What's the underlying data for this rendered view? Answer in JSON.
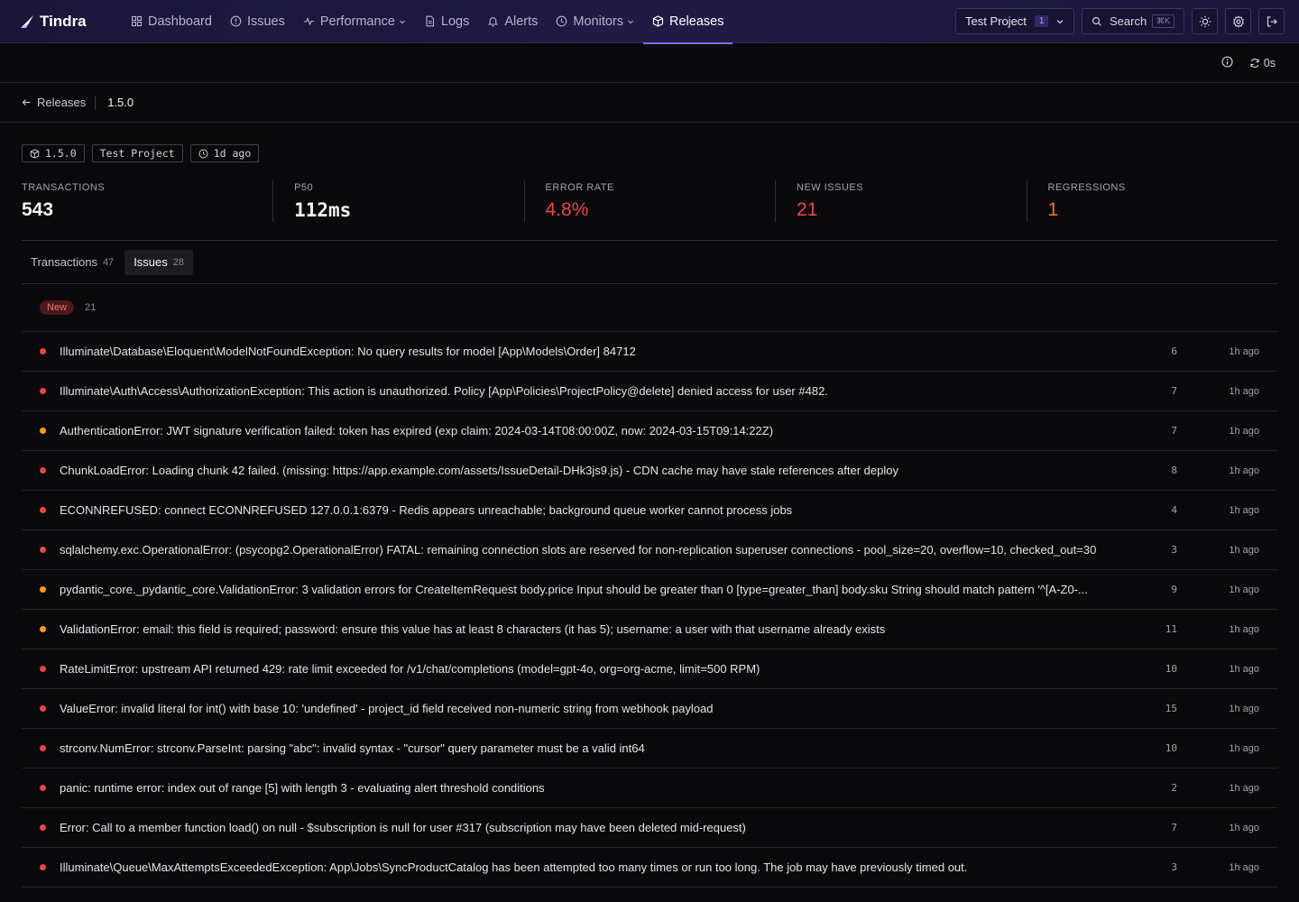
{
  "brand": {
    "name": "Tindra"
  },
  "nav": [
    {
      "label": "Dashboard",
      "icon": "grid-icon",
      "dropdown": false,
      "active": false
    },
    {
      "label": "Issues",
      "icon": "alert-circle-icon",
      "dropdown": false,
      "active": false
    },
    {
      "label": "Performance",
      "icon": "activity-icon",
      "dropdown": true,
      "active": false
    },
    {
      "label": "Logs",
      "icon": "file-text-icon",
      "dropdown": false,
      "active": false
    },
    {
      "label": "Alerts",
      "icon": "bell-icon",
      "dropdown": false,
      "active": false
    },
    {
      "label": "Monitors",
      "icon": "clock-icon",
      "dropdown": true,
      "active": false
    },
    {
      "label": "Releases",
      "icon": "package-icon",
      "dropdown": false,
      "active": true
    }
  ],
  "header": {
    "project": {
      "name": "Test Project",
      "badge": "1"
    },
    "search": {
      "label": "Search",
      "shortcut": "⌘K"
    }
  },
  "subbar": {
    "refresh_label": "0s"
  },
  "breadcrumb": {
    "back_label": "Releases",
    "current": "1.5.0"
  },
  "tags": [
    {
      "icon": "package-icon",
      "label": "1.5.0"
    },
    {
      "icon": "",
      "label": "Test Project"
    },
    {
      "icon": "clock-icon",
      "label": "1d ago"
    }
  ],
  "stats": [
    {
      "label": "TRANSACTIONS",
      "value": "543",
      "tone": "default"
    },
    {
      "label": "P50",
      "value": "112ms",
      "tone": "default"
    },
    {
      "label": "ERROR RATE",
      "value": "4.8%",
      "tone": "red"
    },
    {
      "label": "NEW ISSUES",
      "value": "21",
      "tone": "red"
    },
    {
      "label": "REGRESSIONS",
      "value": "1",
      "tone": "orange"
    }
  ],
  "tabs": [
    {
      "label": "Transactions",
      "count": "47",
      "active": false
    },
    {
      "label": "Issues",
      "count": "28",
      "active": true
    }
  ],
  "colors": {
    "red": "#ef4444",
    "orange": "#f59e0b",
    "accent": "#7c6cf0"
  },
  "issues": {
    "group_label": "New",
    "group_count": "21",
    "rows": [
      {
        "level": "red",
        "title": "Illuminate\\Database\\Eloquent\\ModelNotFoundException: No query results for model [App\\Models\\Order] 84712",
        "count": "6",
        "time": "1h ago"
      },
      {
        "level": "red",
        "title": "Illuminate\\Auth\\Access\\AuthorizationException: This action is unauthorized. Policy [App\\Policies\\ProjectPolicy@delete] denied access for user #482.",
        "count": "7",
        "time": "1h ago"
      },
      {
        "level": "orange",
        "title": "AuthenticationError: JWT signature verification failed: token has expired (exp claim: 2024-03-14T08:00:00Z, now: 2024-03-15T09:14:22Z)",
        "count": "7",
        "time": "1h ago"
      },
      {
        "level": "red",
        "title": "ChunkLoadError: Loading chunk 42 failed. (missing: https://app.example.com/assets/IssueDetail-DHk3js9.js) - CDN cache may have stale references after deploy",
        "count": "8",
        "time": "1h ago"
      },
      {
        "level": "red",
        "title": "ECONNREFUSED: connect ECONNREFUSED 127.0.0.1:6379 - Redis appears unreachable; background queue worker cannot process jobs",
        "count": "4",
        "time": "1h ago"
      },
      {
        "level": "red",
        "title": "sqlalchemy.exc.OperationalError: (psycopg2.OperationalError) FATAL: remaining connection slots are reserved for non-replication superuser connections - pool_size=20, overflow=10, checked_out=30",
        "count": "3",
        "time": "1h ago"
      },
      {
        "level": "orange",
        "title": "pydantic_core._pydantic_core.ValidationError: 3 validation errors for CreateItemRequest body.price Input should be greater than 0 [type=greater_than] body.sku String should match pattern '^[A-Z0-...",
        "count": "9",
        "time": "1h ago"
      },
      {
        "level": "orange",
        "title": "ValidationError: email: this field is required; password: ensure this value has at least 8 characters (it has 5); username: a user with that username already exists",
        "count": "11",
        "time": "1h ago"
      },
      {
        "level": "red",
        "title": "RateLimitError: upstream API returned 429: rate limit exceeded for /v1/chat/completions (model=gpt-4o, org=org-acme, limit=500 RPM)",
        "count": "10",
        "time": "1h ago"
      },
      {
        "level": "red",
        "title": "ValueError: invalid literal for int() with base 10: 'undefined' - project_id field received non-numeric string from webhook payload",
        "count": "15",
        "time": "1h ago"
      },
      {
        "level": "red",
        "title": "strconv.NumError: strconv.ParseInt: parsing \"abc\": invalid syntax - \"cursor\" query parameter must be a valid int64",
        "count": "10",
        "time": "1h ago"
      },
      {
        "level": "red",
        "title": "panic: runtime error: index out of range [5] with length 3 - evaluating alert threshold conditions",
        "count": "2",
        "time": "1h ago"
      },
      {
        "level": "red",
        "title": "Error: Call to a member function load() on null - $subscription is null for user #317 (subscription may have been deleted mid-request)",
        "count": "7",
        "time": "1h ago"
      },
      {
        "level": "red",
        "title": "Illuminate\\Queue\\MaxAttemptsExceededException: App\\Jobs\\SyncProductCatalog has been attempted too many times or run too long. The job may have previously timed out.",
        "count": "3",
        "time": "1h ago"
      }
    ]
  }
}
